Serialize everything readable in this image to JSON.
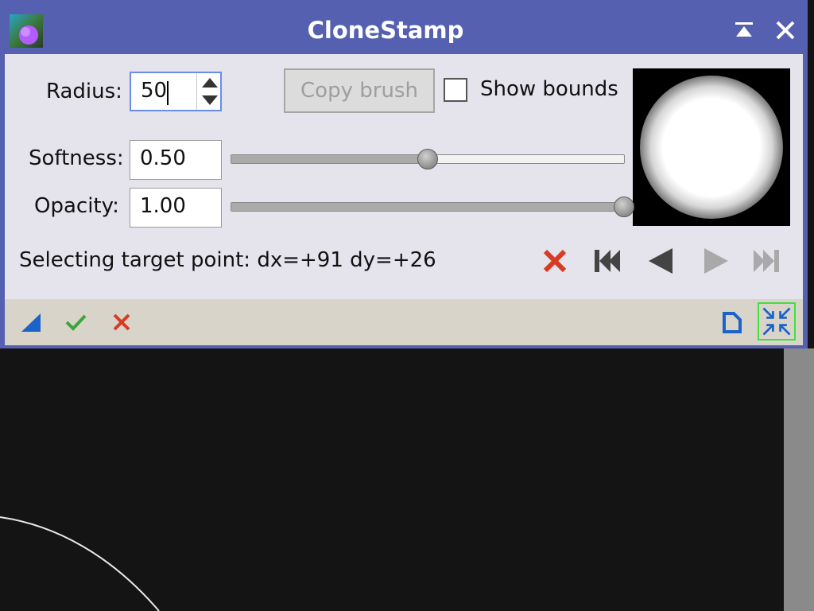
{
  "window": {
    "title": "CloneStamp",
    "icons": {
      "app": "clonestamp-app-icon",
      "shade": "shade-icon",
      "close": "close-icon"
    }
  },
  "brush": {
    "radius_label": "Radius:",
    "radius_value": "50",
    "copy_brush_label": "Copy brush",
    "show_bounds_label": "Show bounds",
    "show_bounds_checked": false,
    "softness_label": "Softness:",
    "softness_value": "0.50",
    "softness_level": 0.5,
    "opacity_label": "Opacity:",
    "opacity_value": "1.00",
    "opacity_level": 1.0
  },
  "status": {
    "text": "Selecting target point: dx=+91 dy=+26"
  },
  "navigation": {
    "buttons": [
      "delete-action-icon",
      "first-action-icon",
      "previous-action-icon",
      "next-action-icon",
      "last-action-icon"
    ]
  },
  "bottom_bar": {
    "icons": [
      "new-instance-icon",
      "apply-icon",
      "cancel-icon",
      "reset-icon",
      "collapse-icon"
    ]
  },
  "colors": {
    "title_bar": "#5560b0",
    "dialog_background": "#e5e3ec",
    "bottom_bar": "#d9d4c9",
    "delete_red": "#d83a22",
    "apply_green": "#3aa63a",
    "accent_blue": "#1b63c8",
    "highlight_green": "#3ee23e"
  }
}
